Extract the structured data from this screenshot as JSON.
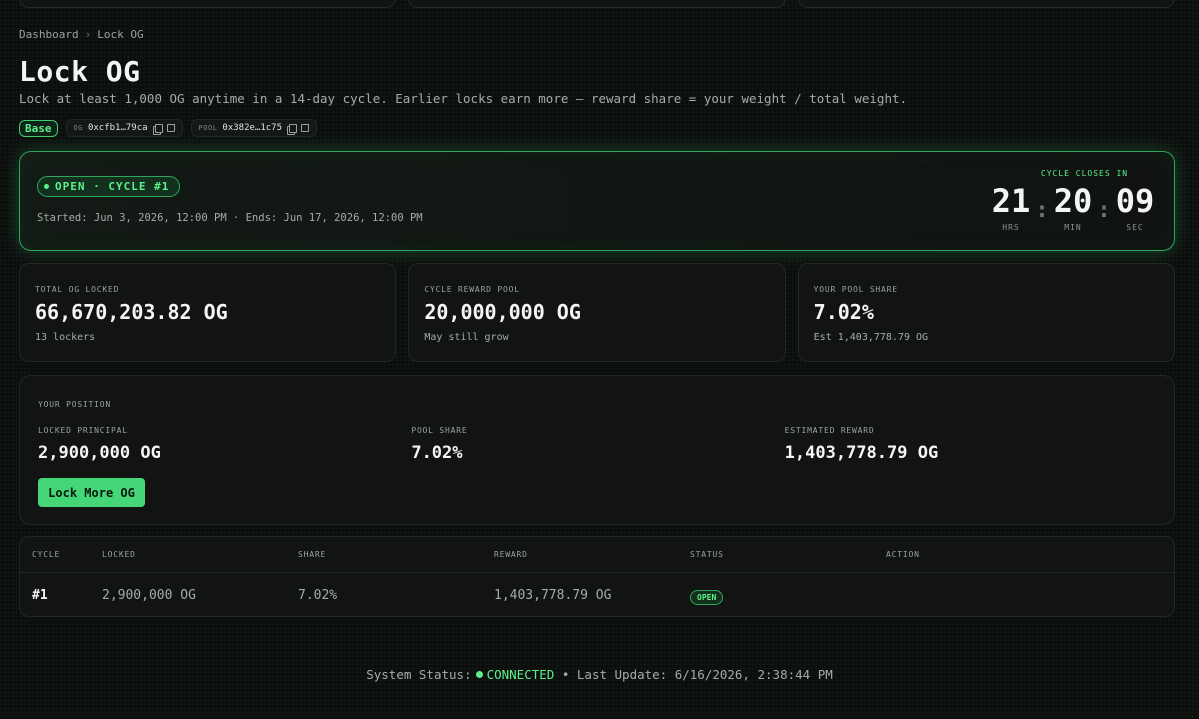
{
  "breadcrumb": {
    "parent": "Dashboard",
    "separator": "›",
    "current": "Lock OG"
  },
  "page": {
    "title": "Lock OG",
    "subtitle": "Lock at least 1,000 OG anytime in a 14-day cycle. Earlier locks earn more — reward share = your weight / total weight."
  },
  "tags": {
    "chain": "Base",
    "og_label": "OG",
    "og_address": "0xcfb1…79ca",
    "pool_label": "POOL",
    "pool_address": "0x382e…1c75"
  },
  "cycle": {
    "status": "OPEN · CYCLE #1",
    "dates": "Started: Jun 3, 2026, 12:00 PM · Ends: Jun 17, 2026, 12:00 PM",
    "countdown_label": "CYCLE CLOSES IN",
    "hours": "21",
    "hours_label": "HRS",
    "minutes": "20",
    "minutes_label": "MIN",
    "seconds": "09",
    "seconds_label": "SEC",
    "separator": ":"
  },
  "stats": [
    {
      "label": "TOTAL OG LOCKED",
      "value": "66,670,203.82 OG",
      "sub": "13 lockers"
    },
    {
      "label": "CYCLE REWARD POOL",
      "value": "20,000,000 OG",
      "sub": "May still grow"
    },
    {
      "label": "YOUR POOL SHARE",
      "value": "7.02%",
      "sub": "Est 1,403,778.79 OG"
    }
  ],
  "position": {
    "title": "YOUR POSITION",
    "principal_label": "LOCKED PRINCIPAL",
    "principal_value": "2,900,000 OG",
    "share_label": "POOL SHARE",
    "share_value": "7.02%",
    "reward_label": "ESTIMATED REWARD",
    "reward_value": "1,403,778.79 OG",
    "lock_more_label": "Lock More OG"
  },
  "table": {
    "headers": [
      "CYCLE",
      "LOCKED",
      "SHARE",
      "REWARD",
      "STATUS",
      "ACTION"
    ],
    "rows": [
      {
        "cycle": "#1",
        "locked": "2,900,000 OG",
        "share": "7.02%",
        "reward": "1,403,778.79 OG",
        "status": "OPEN",
        "action": ""
      }
    ]
  },
  "footer": {
    "label": "System Status:",
    "status": "CONNECTED",
    "update_label": "• Last Update: 6/16/2026, 2:38:44 PM"
  },
  "colors": {
    "accent": "#5ef08c",
    "button": "#45d777",
    "background": "#0c0e0d",
    "card": "#121413"
  }
}
